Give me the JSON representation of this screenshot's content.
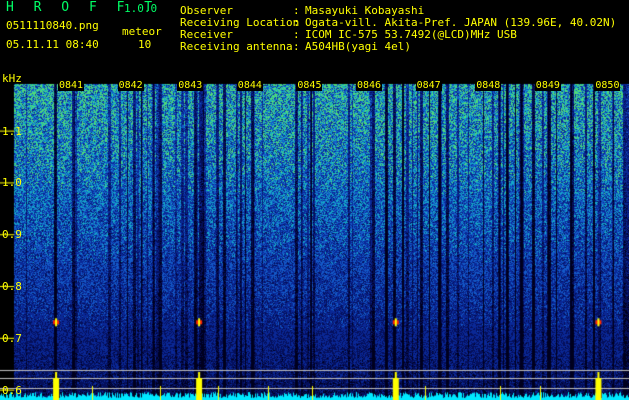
{
  "app": {
    "name": "H R O F F T",
    "version": "1.0.0"
  },
  "file": {
    "name": "0511110840.png",
    "datetime": "05.11.11 08:40"
  },
  "meteor": {
    "label": "meteor",
    "count": "10"
  },
  "info": [
    {
      "label": "Observer",
      "value": "Masayuki Kobayashi"
    },
    {
      "label": "Receiving Location",
      "value": "Ogata-vill. Akita-Pref. JAPAN (139.96E, 40.02N)"
    },
    {
      "label": "Receiver",
      "value": "ICOM IC-575 53.7492(@LCD)MHz USB"
    },
    {
      "label": "Receiving antenna",
      "value": "A504HB(yagi 4el)"
    }
  ],
  "info_separator": ":",
  "colors": {
    "text_yellow": "#ffff00",
    "text_green": "#00ff66",
    "background": "#000000"
  },
  "chart_data": {
    "type": "heatmap",
    "ylabel": "kHz",
    "y_ticks": [
      "1.1",
      "1.0",
      "0.9",
      "0.8",
      "0.7",
      "0.6"
    ],
    "y_range": [
      0.58,
      1.19
    ],
    "x_ticks": [
      "0841",
      "0842",
      "0843",
      "0844",
      "0845",
      "0846",
      "0847",
      "0848",
      "0849",
      "0850"
    ],
    "meteor_echoes": [
      {
        "time": "0840.8",
        "freq_khz": 0.73
      },
      {
        "time": "0843.2",
        "freq_khz": 0.73
      },
      {
        "time": "0846.5",
        "freq_khz": 0.73
      },
      {
        "time": "0849.9",
        "freq_khz": 0.73
      }
    ]
  }
}
